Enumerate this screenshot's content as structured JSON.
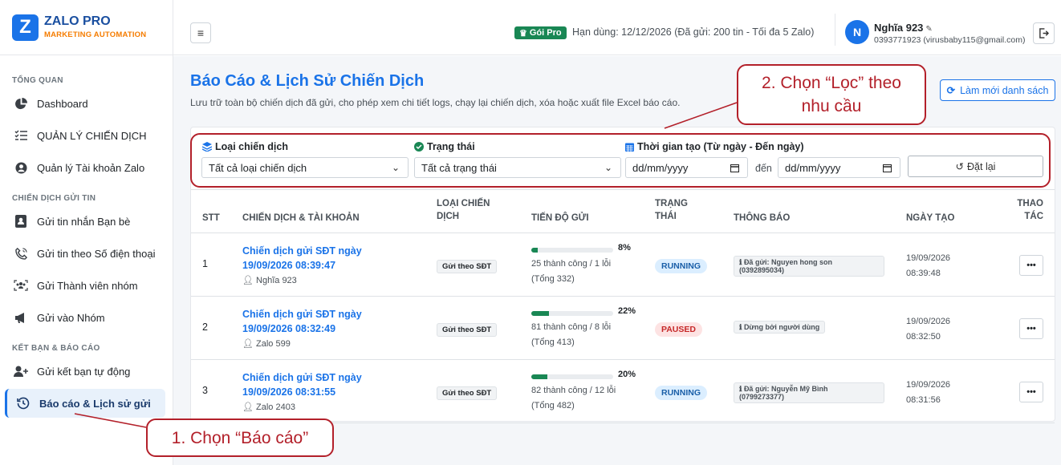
{
  "brand": {
    "logo": "Z",
    "name": "ZALO PRO",
    "sub": "MARKETING AUTOMATION"
  },
  "sidebar": {
    "sections": [
      "TỔNG QUAN",
      "CHIẾN DỊCH GỬI TIN",
      "KẾT BẠN & BÁO CÁO"
    ],
    "items": [
      {
        "label": "Dashboard",
        "icon": "pie-chart-icon"
      },
      {
        "label": "QUẢN LÝ CHIẾN DỊCH",
        "icon": "list-check-icon"
      },
      {
        "label": "Quản lý Tài khoản Zalo",
        "icon": "user-circle-icon"
      },
      {
        "label": "Gửi tin nhắn Bạn bè",
        "icon": "contact-card-icon"
      },
      {
        "label": "Gửi tin theo Số điện thoại",
        "icon": "phone-icon"
      },
      {
        "label": "Gửi Thành viên nhóm",
        "icon": "group-members-icon"
      },
      {
        "label": "Gửi vào Nhóm",
        "icon": "megaphone-icon"
      },
      {
        "label": "Gửi kết bạn tự động",
        "icon": "user-plus-icon"
      },
      {
        "label": "Báo cáo & Lịch sử gửi",
        "icon": "history-icon"
      }
    ]
  },
  "header": {
    "badge": "Gói Pro",
    "expiry": "Hạn dùng: 12/12/2026 (Đã gửi: 200 tin - Tối đa 5 Zalo)",
    "avatar": "N",
    "user_name": "Nghĩa 923",
    "user_info": "0393771923 (virusbaby115@gmail.com)"
  },
  "page": {
    "title": "Báo Cáo & Lịch Sử Chiến Dịch",
    "description": "Lưu trữ toàn bộ chiến dịch đã gửi, cho phép xem chi tiết logs, chạy lại chiến dịch, xóa hoặc xuất file Excel báo cáo.",
    "refresh": "Làm mới danh sách"
  },
  "filters": {
    "type_label": "Loại chiến dịch",
    "type_value": "Tất cả loại chiến dịch",
    "status_label": "Trạng thái",
    "status_value": "Tất cả trạng thái",
    "date_label": "Thời gian tạo (Từ ngày - Đến ngày)",
    "date_from": "dd/mm/yyyy",
    "date_sep": "đến",
    "date_to": "dd/mm/yyyy",
    "reset": "Đặt lại"
  },
  "table": {
    "headers": {
      "stt": "STT",
      "campaign": "CHIẾN DỊCH & TÀI KHOẢN",
      "type_1": "LOẠI CHIẾN",
      "type_2": "DỊCH",
      "progress": "TIẾN ĐỘ GỬI",
      "status_1": "TRẠNG",
      "status_2": "THÁI",
      "notice": "THÔNG BÁO",
      "date": "NGÀY TẠO",
      "action_1": "THAO",
      "action_2": "TÁC"
    },
    "rows": [
      {
        "stt": "1",
        "title_1": "Chiến dịch gửi SĐT ngày",
        "title_2": "19/09/2026 08:39:47",
        "account": "Nghĩa 923",
        "type": "Gửi theo SĐT",
        "percent": 8,
        "percent_text": "8%",
        "stat_1": "25 thành công / 1 lỗi",
        "stat_2": "(Tổng 332)",
        "status": "RUNNING",
        "status_kind": "running",
        "notice_1": "Đã gửi: Nguyen hong son",
        "notice_2": "(0392895034)",
        "date_1": "19/09/2026",
        "date_2": "08:39:48",
        "more": "•••"
      },
      {
        "stt": "2",
        "title_1": "Chiến dịch gửi SĐT ngày",
        "title_2": "19/09/2026 08:32:49",
        "account": "Zalo 599",
        "type": "Gửi theo SĐT",
        "percent": 22,
        "percent_text": "22%",
        "stat_1": "81 thành công / 8 lỗi",
        "stat_2": "(Tổng 413)",
        "status": "PAUSED",
        "status_kind": "paused",
        "notice_1": "Dừng bởi người dùng",
        "notice_2": "",
        "date_1": "19/09/2026",
        "date_2": "08:32:50",
        "more": "•••"
      },
      {
        "stt": "3",
        "title_1": "Chiến dịch gửi SĐT ngày",
        "title_2": "19/09/2026 08:31:55",
        "account": "Zalo 2403",
        "type": "Gửi theo SĐT",
        "percent": 20,
        "percent_text": "20%",
        "stat_1": "82 thành công / 12 lỗi",
        "stat_2": "(Tổng 482)",
        "status": "RUNNING",
        "status_kind": "running",
        "notice_1": "Đã gửi: Nguyễn Mỹ Bình",
        "notice_2": "(0799273377)",
        "date_1": "19/09/2026",
        "date_2": "08:31:56",
        "more": "•••"
      }
    ]
  },
  "annotations": {
    "step1": "1. Chọn “Báo cáo”",
    "step2_1": "2. Chọn “Lọc” theo",
    "step2_2": "nhu cầu"
  },
  "colors": {
    "accent": "#1a73e8",
    "brand_orange": "#f57c00",
    "success": "#198754",
    "annotation": "#b3202a"
  }
}
